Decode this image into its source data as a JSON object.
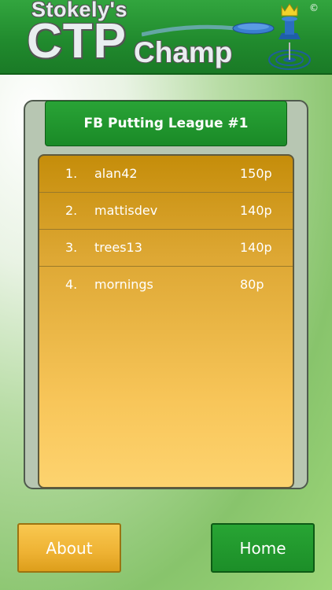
{
  "header": {
    "logo_line1": "Stokely's",
    "logo_ctp": "CTP",
    "logo_champ": "Champ",
    "copyright": "©"
  },
  "league": {
    "title": "FB Putting League #1",
    "standings": [
      {
        "rank": "1.",
        "name": "alan42",
        "points": "150p"
      },
      {
        "rank": "2.",
        "name": "mattisdev",
        "points": "140p"
      },
      {
        "rank": "3.",
        "name": "trees13",
        "points": "140p"
      },
      {
        "rank": "4.",
        "name": "mornings",
        "points": "80p"
      }
    ]
  },
  "buttons": {
    "about": "About",
    "home": "Home"
  },
  "colors": {
    "header_green": "#218b2e",
    "title_green": "#1a8a27",
    "list_gold": "#dda733",
    "about_gold": "#eeb233"
  }
}
